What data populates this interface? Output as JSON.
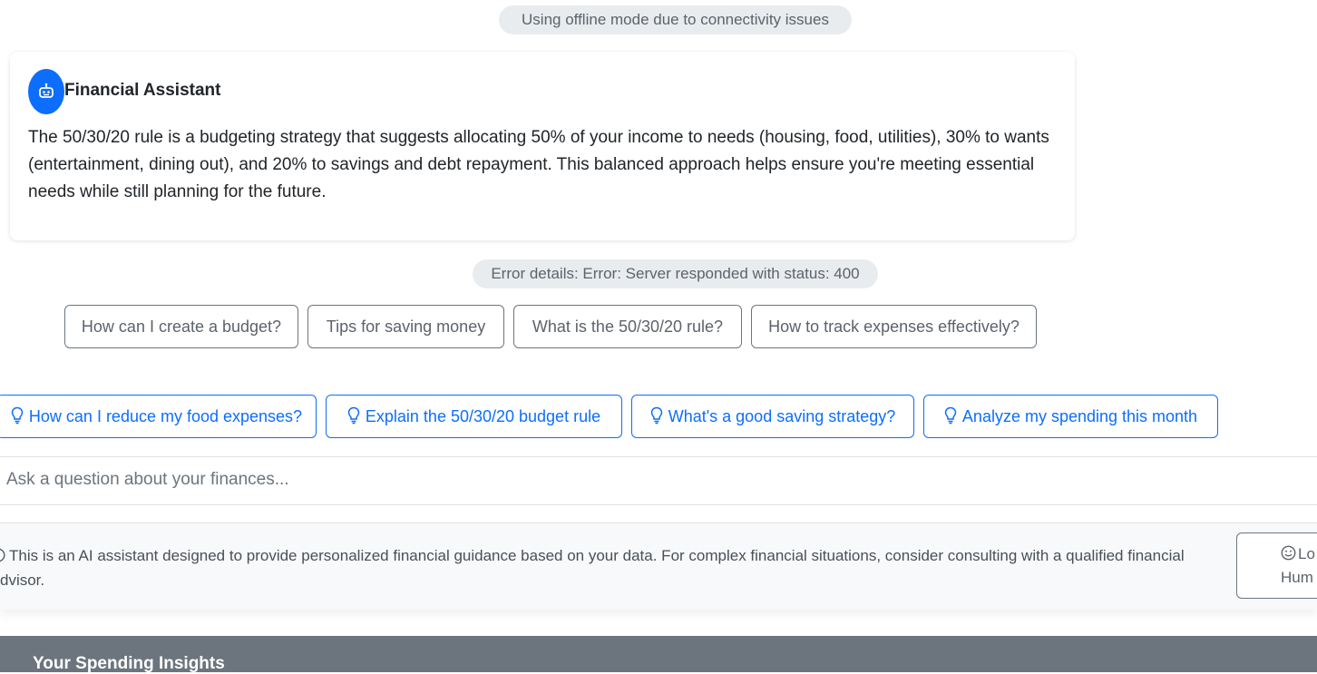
{
  "status": {
    "offline_notice": "Using offline mode due to connectivity issues",
    "error_details": "Error details: Error: Server responded with status: 400"
  },
  "assistant_message": {
    "avatar_icon": "robot-icon",
    "title": "Financial Assistant",
    "text": "The 50/30/20 rule is a budgeting strategy that suggests allocating 50% of your income to needs (housing, food, utilities), 30% to wants (entertainment, dining out), and 20% to savings and debt repayment. This balanced approach helps ensure you're meeting essential needs while still planning for the future."
  },
  "quick_questions": [
    "How can I create a budget?",
    "Tips for saving money",
    "What is the 50/30/20 rule?",
    "How to track expenses effectively?"
  ],
  "suggestions": {
    "icon": "lightbulb-icon",
    "items": [
      "How can I reduce my food expenses?",
      "Explain the 50/30/20 budget rule",
      "What's a good saving strategy?",
      "Analyze my spending this month"
    ]
  },
  "chat_input": {
    "placeholder": "Ask a question about your finances..."
  },
  "footer": {
    "disclaimer_icon": "info-circle-icon",
    "disclaimer_line1": "This is an AI assistant designed to provide personalized financial guidance based on your data. For complex financial situations, consider consulting with a qualified financial",
    "disclaimer_line2": "dvisor.",
    "human_button_icon": "smiley-icon",
    "human_button_line1": "Lo",
    "human_button_line2": "Hum"
  },
  "bottom_section": {
    "title": "Your Spending Insights"
  },
  "colors": {
    "primary": "#0d6efd",
    "secondary": "#6c757d",
    "pill_bg": "#e9ecef",
    "footer_bg": "#f8f9fa"
  }
}
